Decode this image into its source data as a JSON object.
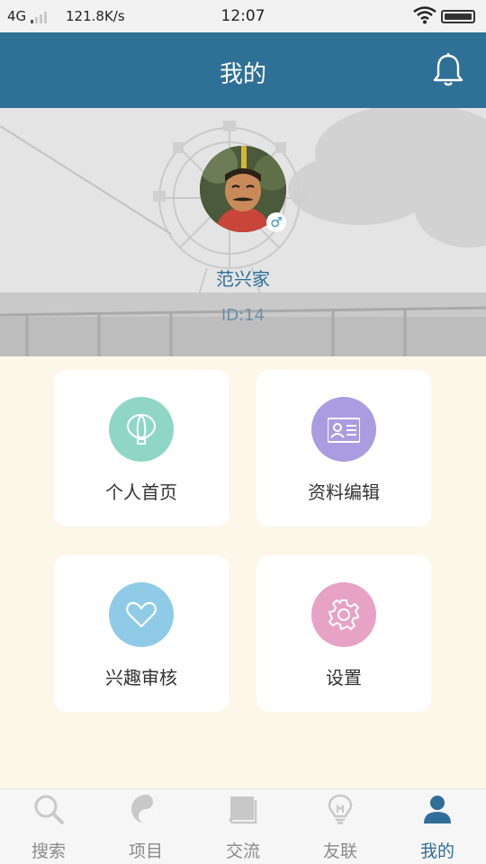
{
  "status_bar": {
    "network": "4G",
    "speed": "121.8K/s",
    "time": "12:07"
  },
  "header": {
    "title": "我的"
  },
  "profile": {
    "name": "范兴家",
    "id_text": "ID:14",
    "gender_symbol": "♂"
  },
  "menu": [
    {
      "label": "个人首页",
      "icon": "balloon-icon",
      "color": "#8fd6c6"
    },
    {
      "label": "资料编辑",
      "icon": "id-card-icon",
      "color": "#a99de0"
    },
    {
      "label": "兴趣审核",
      "icon": "heart-icon",
      "color": "#8fcbe6"
    },
    {
      "label": "设置",
      "icon": "gear-icon",
      "color": "#e6a3c5"
    }
  ],
  "tabbar": {
    "items": [
      {
        "label": "搜索",
        "icon": "search-icon"
      },
      {
        "label": "项目",
        "icon": "yin-yang-icon"
      },
      {
        "label": "交流",
        "icon": "book-icon"
      },
      {
        "label": "友联",
        "icon": "lightbulb-icon"
      },
      {
        "label": "我的",
        "icon": "person-icon"
      }
    ],
    "active_index": 4
  },
  "colors": {
    "header": "#2f7096",
    "page_background": "#fdf7ea",
    "accent": "#2f6e98"
  }
}
